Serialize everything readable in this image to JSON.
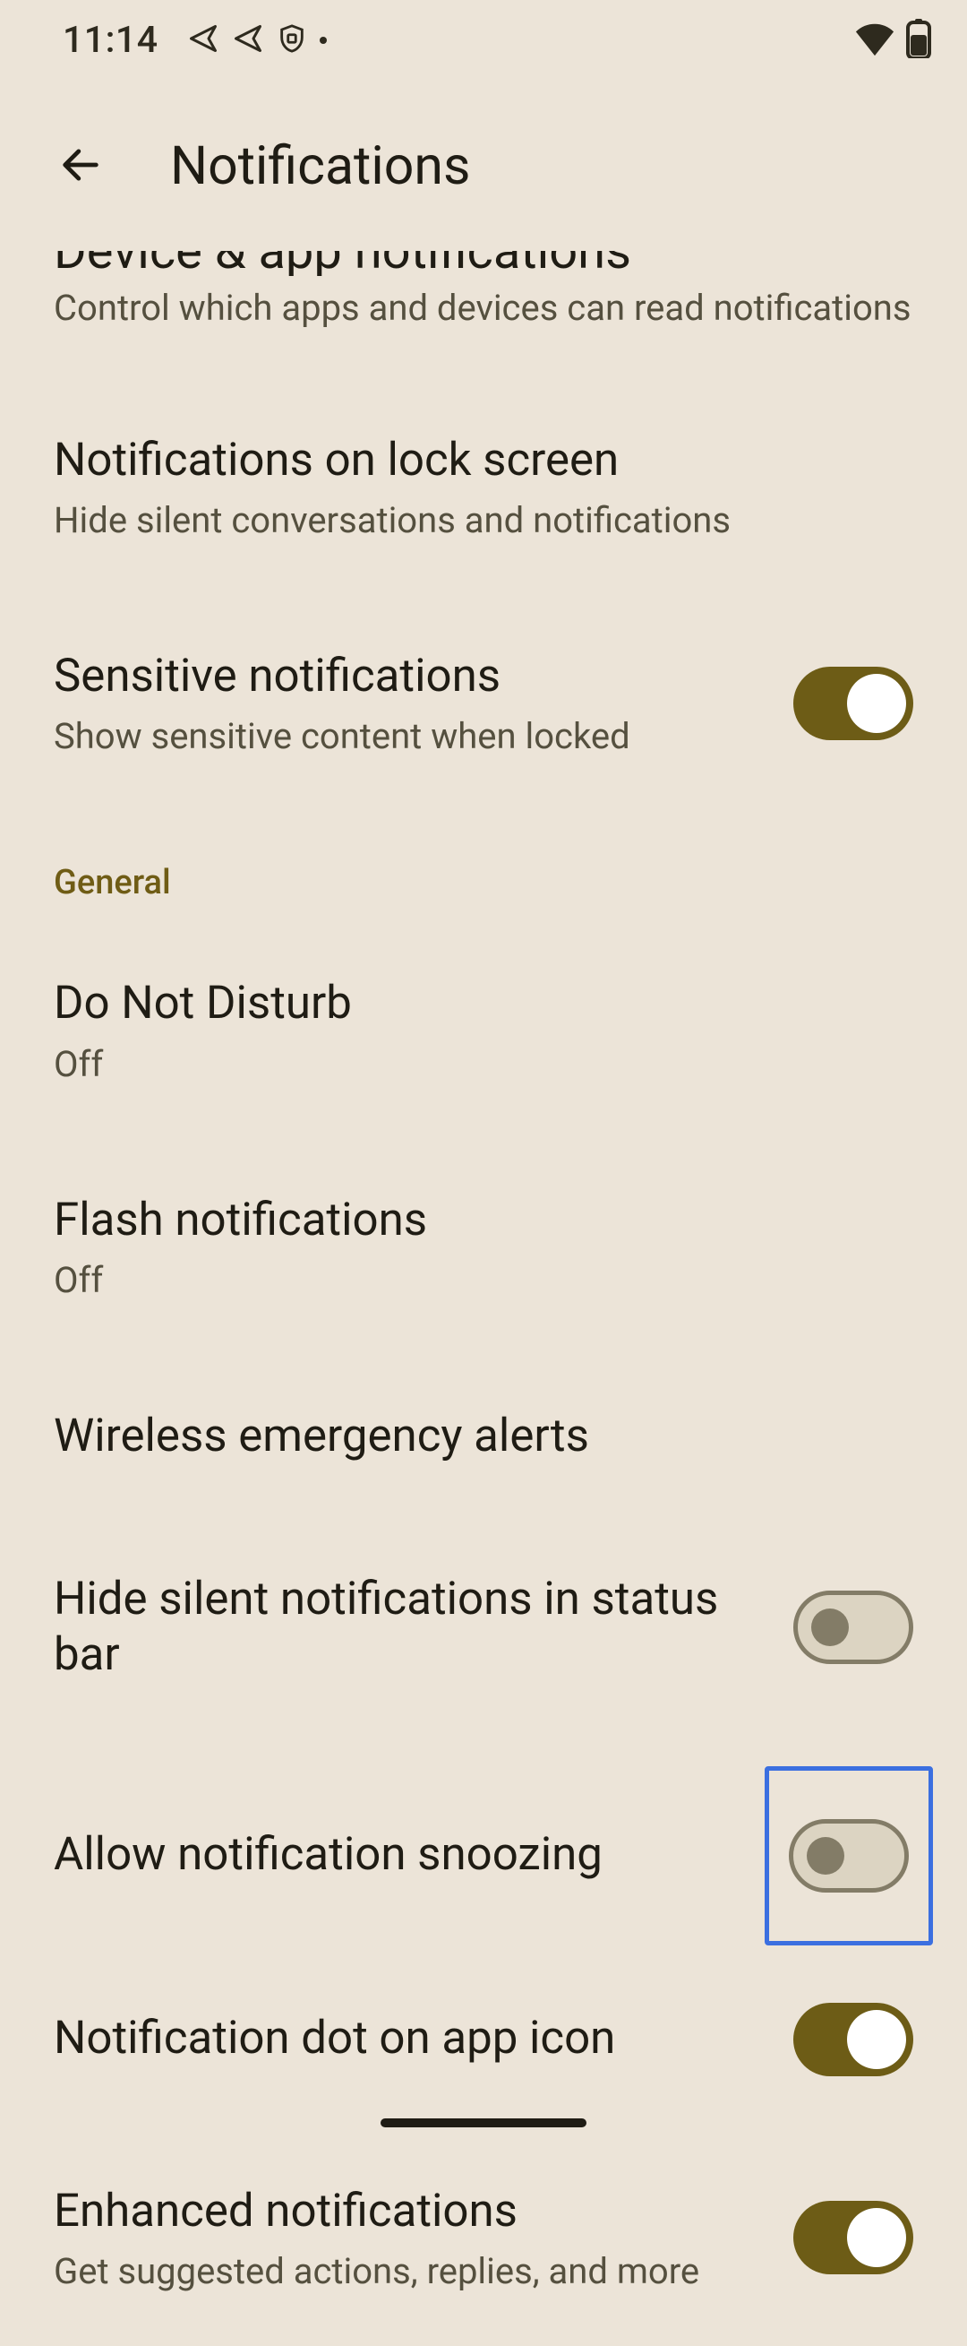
{
  "status": {
    "time": "11:14"
  },
  "header": {
    "title": "Notifications"
  },
  "items": {
    "deviceApp": {
      "title": "Device & app notifications",
      "sub": "Control which apps and devices can read notifications"
    },
    "lockScreen": {
      "title": "Notifications on lock screen",
      "sub": "Hide silent conversations and notifications"
    },
    "sensitive": {
      "title": "Sensitive notifications",
      "sub": "Show sensitive content when locked",
      "on": true
    },
    "dnd": {
      "title": "Do Not Disturb",
      "sub": "Off"
    },
    "flash": {
      "title": "Flash notifications",
      "sub": "Off"
    },
    "emergency": {
      "title": "Wireless emergency alerts"
    },
    "hideSilent": {
      "title": "Hide silent notifications in status bar",
      "on": false
    },
    "snooze": {
      "title": "Allow notification snoozing",
      "on": false
    },
    "dot": {
      "title": "Notification dot on app icon",
      "on": true
    },
    "enhanced": {
      "title": "Enhanced notifications",
      "sub": "Get suggested actions, replies, and more",
      "on": true
    }
  },
  "sections": {
    "general": "General"
  }
}
